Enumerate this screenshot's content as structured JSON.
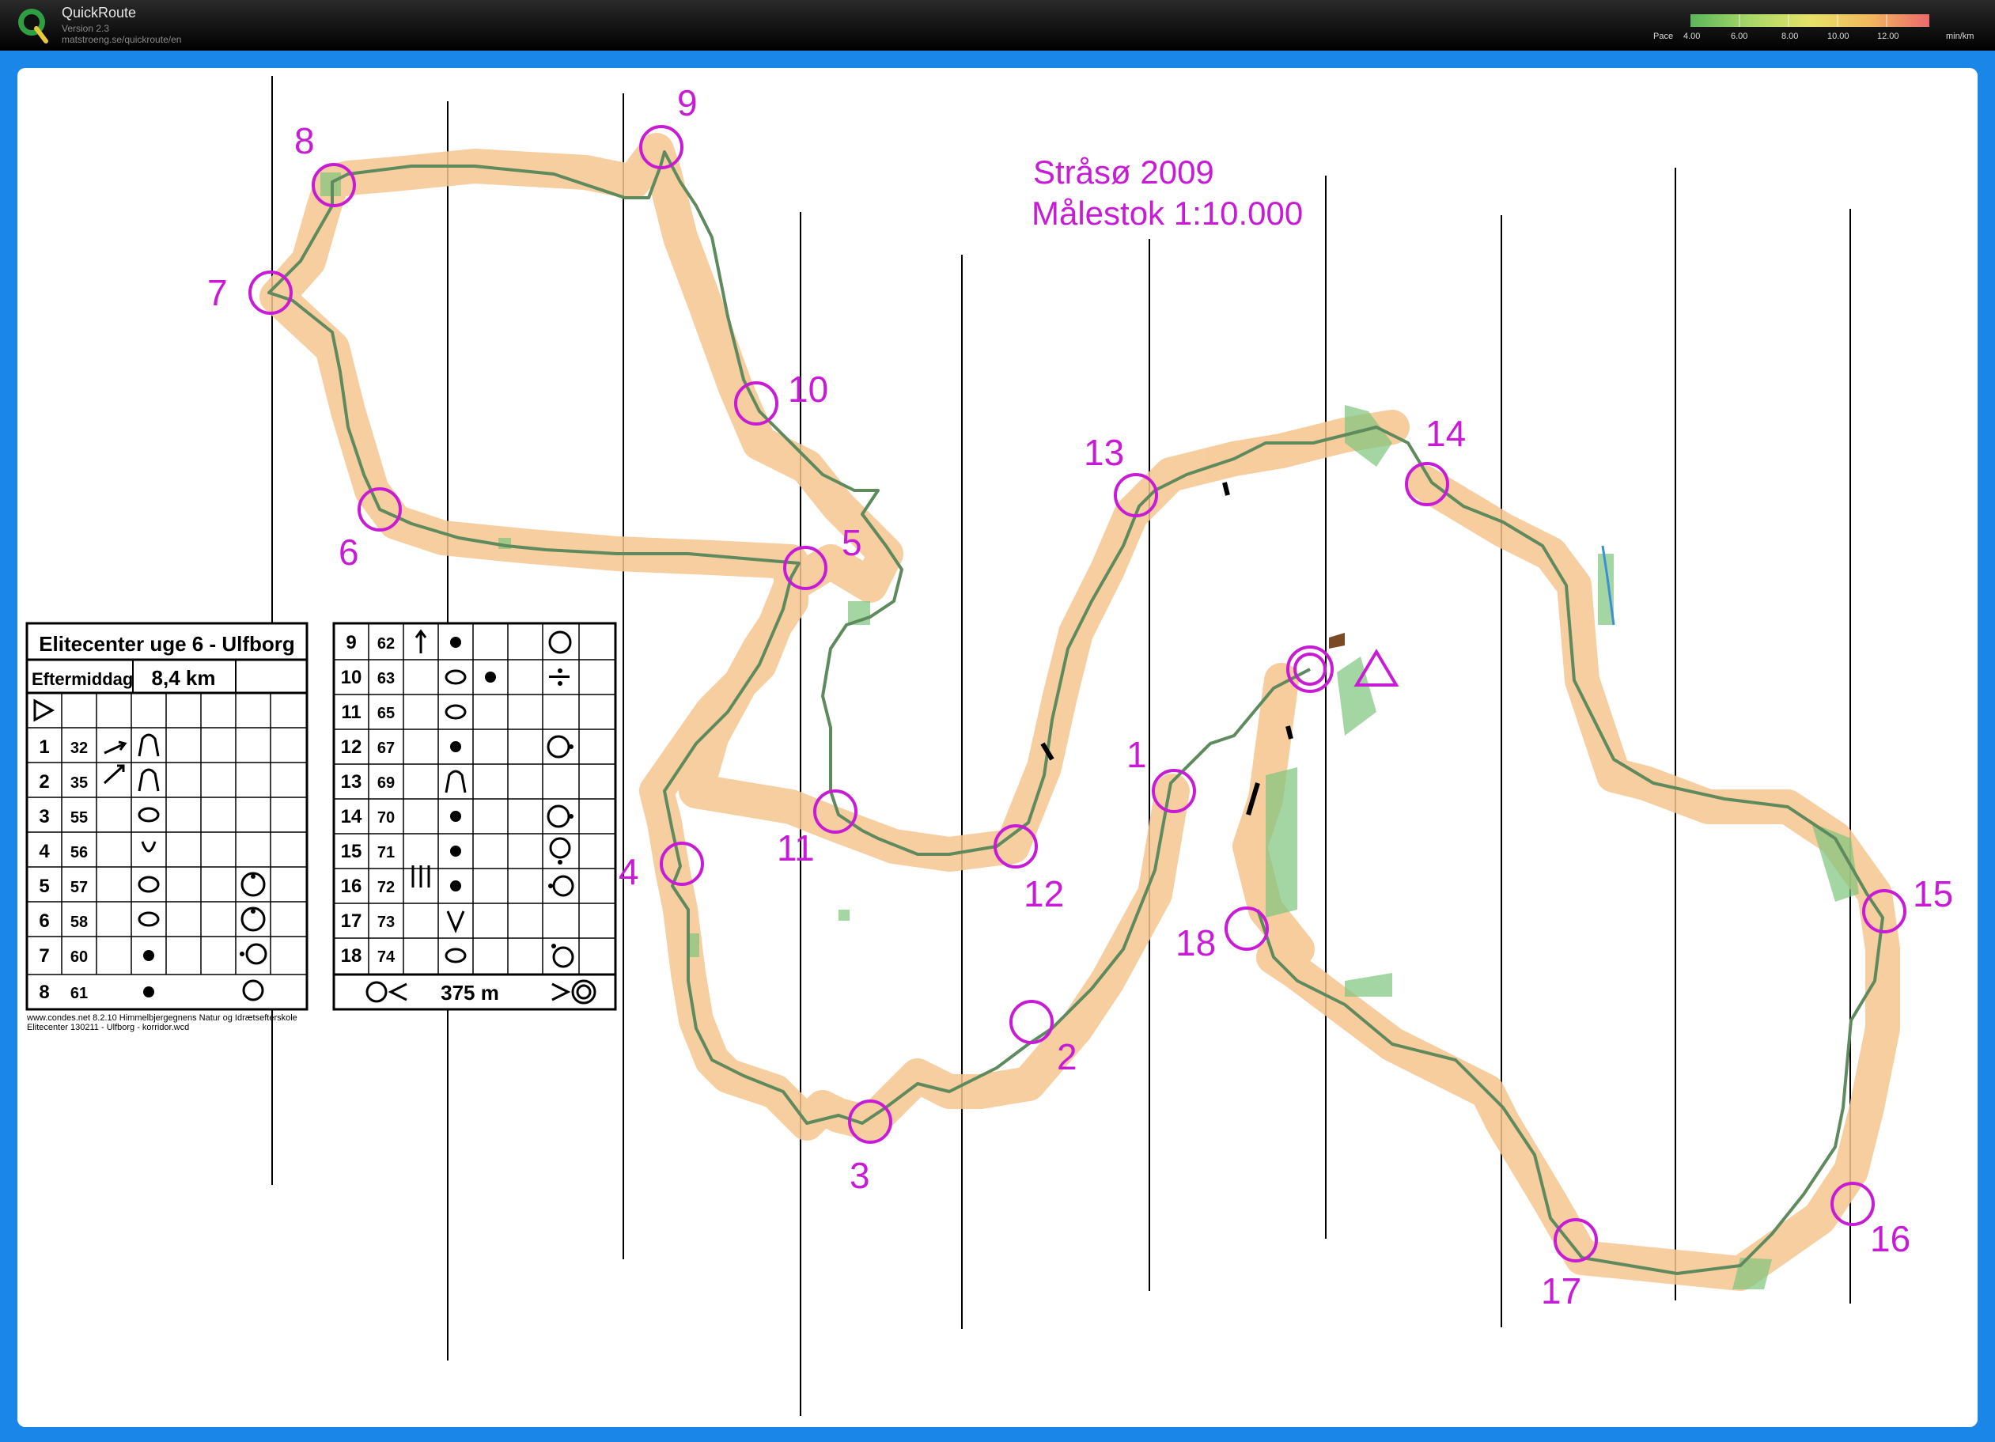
{
  "app": {
    "title": "QuickRoute",
    "version": "Version 2.3",
    "url": "matstroeng.se/quickroute/en"
  },
  "pace_legend": {
    "label": "Pace",
    "ticks": [
      "4.00",
      "6.00",
      "8.00",
      "10.00",
      "12.00"
    ],
    "unit": "min/km",
    "colors": [
      "#5bb55b",
      "#a8d868",
      "#e6e26a",
      "#f2b85e",
      "#ea6a6a"
    ]
  },
  "map": {
    "title_line1": "Stråsø 2009",
    "title_line2": "Målestok 1:10.000",
    "accent_color": "#c81bd6",
    "route_color": "#5e8a5e",
    "corridor_color": "#f6c58e",
    "controls": [
      "1",
      "2",
      "3",
      "4",
      "5",
      "6",
      "7",
      "8",
      "9",
      "10",
      "11",
      "12",
      "13",
      "14",
      "15",
      "16",
      "17",
      "18"
    ]
  },
  "description_sheet": {
    "event": "Elitecenter uge 6 - Ulfborg",
    "class": "Eftermiddag",
    "length": "8,4 km",
    "rows_left": [
      {
        "n": "1",
        "code": "32"
      },
      {
        "n": "2",
        "code": "35"
      },
      {
        "n": "3",
        "code": "55"
      },
      {
        "n": "4",
        "code": "56"
      },
      {
        "n": "5",
        "code": "57"
      },
      {
        "n": "6",
        "code": "58"
      },
      {
        "n": "7",
        "code": "60"
      },
      {
        "n": "8",
        "code": "61"
      }
    ],
    "rows_right": [
      {
        "n": "9",
        "code": "62"
      },
      {
        "n": "10",
        "code": "63"
      },
      {
        "n": "11",
        "code": "65"
      },
      {
        "n": "12",
        "code": "67"
      },
      {
        "n": "13",
        "code": "69"
      },
      {
        "n": "14",
        "code": "70"
      },
      {
        "n": "15",
        "code": "71"
      },
      {
        "n": "16",
        "code": "72"
      },
      {
        "n": "17",
        "code": "73"
      },
      {
        "n": "18",
        "code": "74"
      }
    ],
    "finish_distance": "375 m",
    "footer_line1": "www.condes.net 8.2.10 Himmelbjergegnens Natur og Idrætsefterskole",
    "footer_line2": "Elitecenter 130211 - Ulfborg - korridor.wcd"
  }
}
